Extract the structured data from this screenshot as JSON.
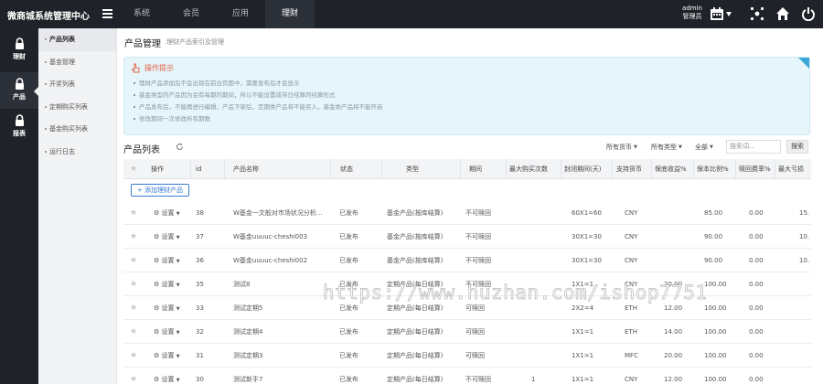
{
  "topbar": {
    "brand": "微商城系统管理中心",
    "nav": [
      "系统",
      "会员",
      "应用",
      "理财"
    ],
    "active_nav": 3,
    "admin_name": "admin",
    "admin_role": "管理员"
  },
  "sidebar": {
    "items": [
      {
        "label": "理财",
        "icon": "lock-icon"
      },
      {
        "label": "产品",
        "icon": "lock-icon"
      },
      {
        "label": "报表",
        "icon": "lock-icon"
      }
    ],
    "active": 1
  },
  "submenu": {
    "items": [
      "产品列表",
      "基金管理",
      "开奖列表",
      "定期购买列表",
      "基金购买列表",
      "运行日志"
    ],
    "active": 0
  },
  "page": {
    "title": "产品管理",
    "subtitle": "理财产品索引及管理"
  },
  "tips": {
    "title": "操作提示",
    "lines": [
      "理财产品添加后不会出现在前台页面中，需要发布后才会显示",
      "基金类型的产品因为会有每期的期间，所以不能设置成带日结算的结算形式",
      "产品发布后，不能再进行编辑，产品下架后，定期类产品将不能买入，基金类产品将不能开启",
      "修改期间一次修改所有期数"
    ]
  },
  "list": {
    "title": "产品列表",
    "filters": [
      "所有货币",
      "所有类型",
      "全部"
    ],
    "search_placeholder": "搜索词...",
    "search_button": "搜索",
    "add_button": "添加理财产品"
  },
  "table": {
    "headers": [
      "操作",
      "id",
      "产品名称",
      "状态",
      "类型",
      "期间",
      "最大购买次数",
      "封闭期间(天)",
      "支持货币",
      "保底收益%",
      "保本比例%",
      "赎回费率%",
      "最大亏损"
    ],
    "action_label": "设置",
    "rows": [
      {
        "id": "38",
        "name": "W基金一文般对市场状况分析...",
        "status": "已发布",
        "type": "基金产品(按库结算)",
        "period": "不可赎回",
        "max_buy": "",
        "closed": "60X1=60",
        "currency": "CNY",
        "min_yield": "",
        "principal": "85.00",
        "redeem": "0.00",
        "max_loss": "15."
      },
      {
        "id": "37",
        "name": "W基金uuuuc-cheshi003",
        "status": "已发布",
        "type": "基金产品(按库结算)",
        "period": "不可赎回",
        "max_buy": "",
        "closed": "30X1=30",
        "currency": "CNY",
        "min_yield": "",
        "principal": "90.00",
        "redeem": "0.00",
        "max_loss": "10."
      },
      {
        "id": "36",
        "name": "W基金uuuuc-cheshi002",
        "status": "已发布",
        "type": "基金产品(按库结算)",
        "period": "不可赎回",
        "max_buy": "",
        "closed": "30X1=30",
        "currency": "CNY",
        "min_yield": "",
        "principal": "90.00",
        "redeem": "0.00",
        "max_loss": "10."
      },
      {
        "id": "35",
        "name": "测试8",
        "status": "已发布",
        "type": "定期产品(每日结算)",
        "period": "不可赎回",
        "max_buy": "",
        "closed": "1X1=1",
        "currency": "CNY",
        "min_yield": "20.00",
        "principal": "100.00",
        "redeem": "0.00",
        "max_loss": ""
      },
      {
        "id": "33",
        "name": "测试定期5",
        "status": "已发布",
        "type": "定期产品(每日结算)",
        "period": "可赎回",
        "max_buy": "",
        "closed": "2X2=4",
        "currency": "ETH",
        "min_yield": "12.00",
        "principal": "100.00",
        "redeem": "0.00",
        "max_loss": ""
      },
      {
        "id": "32",
        "name": "测试定期4",
        "status": "已发布",
        "type": "定期产品(每日结算)",
        "period": "可赎回",
        "max_buy": "",
        "closed": "1X1=1",
        "currency": "ETH",
        "min_yield": "14.00",
        "principal": "100.00",
        "redeem": "0.00",
        "max_loss": ""
      },
      {
        "id": "31",
        "name": "测试定期3",
        "status": "已发布",
        "type": "定期产品(每日结算)",
        "period": "可赎回",
        "max_buy": "",
        "closed": "1X1=1",
        "currency": "MFC",
        "min_yield": "20.00",
        "principal": "100.00",
        "redeem": "0.00",
        "max_loss": ""
      },
      {
        "id": "30",
        "name": "测试新手7",
        "status": "已发布",
        "type": "定期产品(每日结算)",
        "period": "不可赎回",
        "max_buy": "1",
        "closed": "1X1=1",
        "currency": "CNY",
        "min_yield": "12.00",
        "principal": "100.00",
        "redeem": "0.00",
        "max_loss": ""
      }
    ]
  },
  "watermark": "https://www.huzhan.com/ishop7751",
  "colors": {
    "topbar": "#1f2228",
    "accent": "#3a7bd5",
    "tip_bg": "#e6f5fa",
    "tip_title": "#e0603e"
  }
}
